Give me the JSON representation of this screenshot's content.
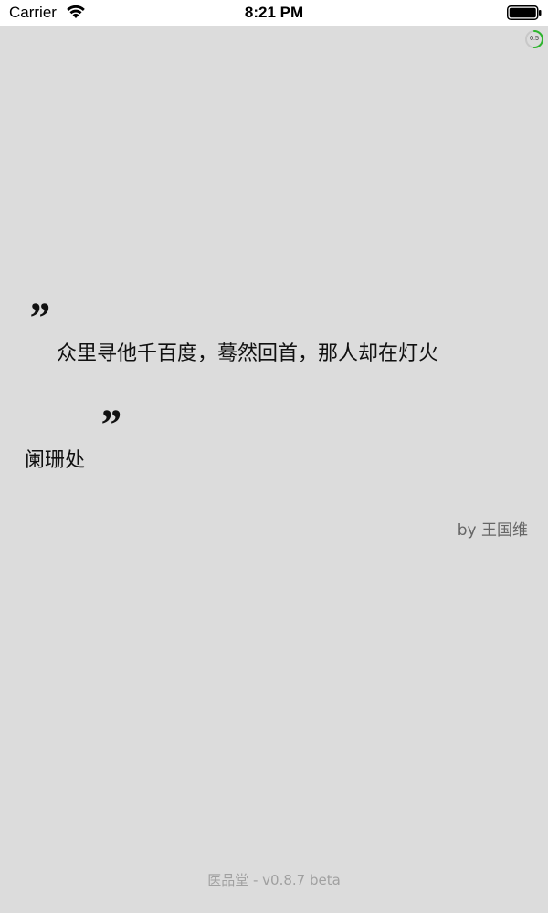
{
  "status_bar": {
    "carrier": "Carrier",
    "time": "8:21 PM",
    "wifi_icon": "wifi-icon",
    "battery_icon": "battery-icon"
  },
  "progress": {
    "label": "0.5",
    "fraction": 0.5,
    "color": "#2db52d"
  },
  "quote": {
    "open_mark": "”",
    "close_mark": "”",
    "line1": "众里寻他千百度，蓦然回首，那人却在灯火",
    "line2": "阑珊处",
    "author": "by 王国维"
  },
  "footer": {
    "version": "医品堂 - v0.8.7 beta"
  },
  "colors": {
    "background": "#dcdcdc",
    "status_bar": "#ffffff",
    "text": "#111111",
    "author": "#666666",
    "footer": "#a0a0a0"
  }
}
